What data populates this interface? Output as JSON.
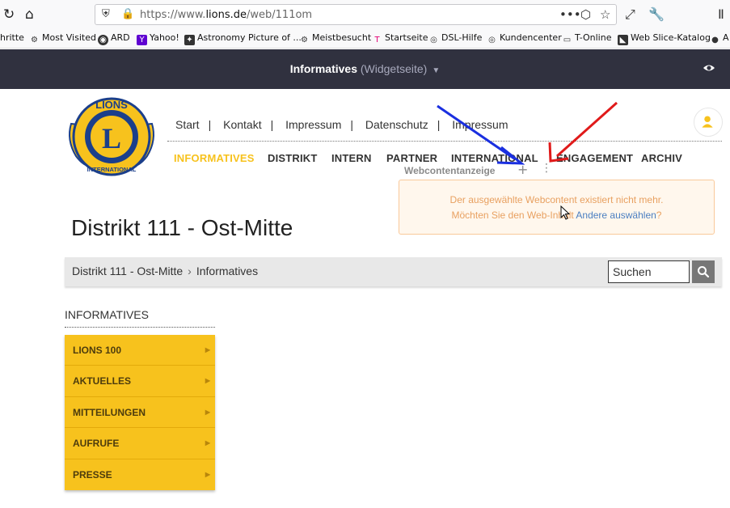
{
  "browser": {
    "url_prefix": "https://www.",
    "url_domain": "lions.de",
    "url_path": "/web/111om",
    "bookmarks": [
      {
        "label": "hritte",
        "icon": "none"
      },
      {
        "label": "Most Visited",
        "icon": "gear-icon"
      },
      {
        "label": "ARD",
        "icon": "ard-icon"
      },
      {
        "label": "Yahoo!",
        "icon": "yahoo-icon"
      },
      {
        "label": "Astronomy Picture of ...",
        "icon": "apod-icon"
      },
      {
        "label": "Meistbesucht",
        "icon": "gear-icon"
      },
      {
        "label": "Startseite",
        "icon": "telekom-icon"
      },
      {
        "label": "DSL-Hilfe",
        "icon": "globe-icon"
      },
      {
        "label": "Kundencenter",
        "icon": "globe-icon"
      },
      {
        "label": "T-Online",
        "icon": "folder-icon"
      },
      {
        "label": "Web Slice-Katalog",
        "icon": "webslice-icon"
      },
      {
        "label": "A",
        "icon": "apple-icon"
      }
    ]
  },
  "topbar": {
    "title": "Informatives",
    "subtitle": "(Widgetseite)"
  },
  "header": {
    "topnav": [
      "Start",
      "Kontakt",
      "Impressum",
      "Datenschutz",
      "Impressum"
    ],
    "mainnav": [
      "INFORMATIVES",
      "DISTRIKT",
      "INTERN",
      "PARTNER",
      "INTERNATIONAL",
      "ENGAGEMENT",
      "ARCHIV"
    ]
  },
  "widget": {
    "label": "Webcontentanzeige",
    "alert_line1": "Der ausgewählte Webcontent existiert nicht mehr.",
    "alert_line2_pre": "Möchten Sie den Web-Inhalt",
    "alert_link": "Andere auswählen",
    "alert_line2_post": "?"
  },
  "page": {
    "title": "Distrikt 111 - Ost-Mitte",
    "breadcrumb": [
      "Distrikt 111 - Ost-Mitte",
      "Informatives"
    ],
    "search_placeholder": "Suchen"
  },
  "sidebar": {
    "heading": "INFORMATIVES",
    "items": [
      "LIONS 100",
      "AKTUELLES",
      "MITTEILUNGEN",
      "AUFRUFE",
      "PRESSE"
    ]
  },
  "colors": {
    "accent": "#f7c21d",
    "topbar": "#30313f",
    "arrow_blue": "#1a2fe0",
    "arrow_red": "#e01a1a"
  }
}
